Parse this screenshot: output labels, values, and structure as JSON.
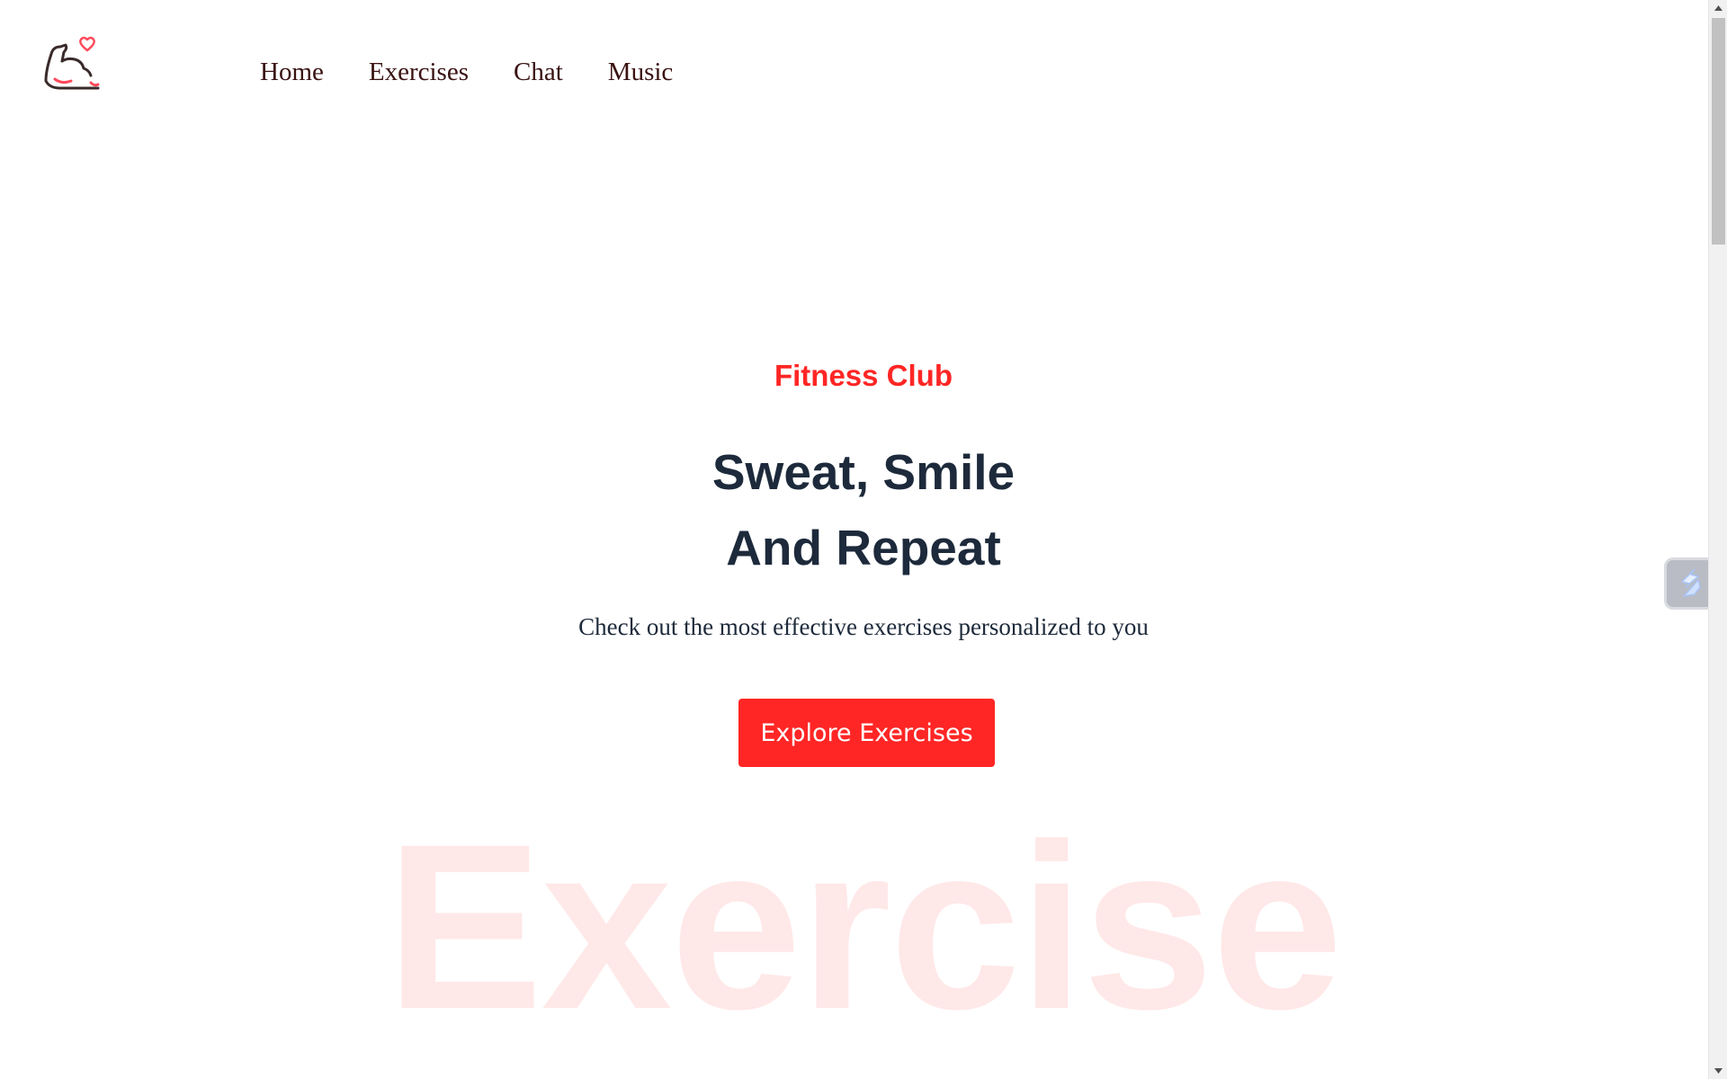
{
  "nav": {
    "items": [
      {
        "label": "Home"
      },
      {
        "label": "Exercises"
      },
      {
        "label": "Chat"
      },
      {
        "label": "Music"
      }
    ]
  },
  "hero": {
    "eyebrow": "Fitness Club",
    "headline_line1": "Sweat, Smile",
    "headline_line2": "And Repeat",
    "subtitle": "Check out the most effective exercises personalized to you",
    "cta_label": "Explore Exercises",
    "watermark": "Exercise"
  },
  "icons": {
    "logo": "flexed-arm-heart-icon",
    "float_widget": "lightning-icon",
    "scroll_up": "triangle-up-icon",
    "scroll_down": "triangle-down-icon"
  },
  "colors": {
    "accent": "#ff2625",
    "heading": "#1d2a3b",
    "nav_text": "#3a1212",
    "background": "#ffffff"
  }
}
